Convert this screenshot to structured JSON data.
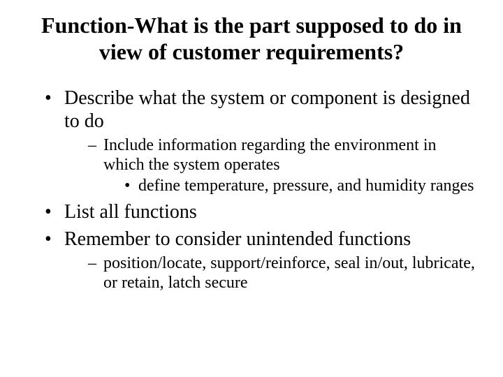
{
  "title": "Function-What is the part supposed to do in view of customer requirements?",
  "bullets": {
    "b1": "Describe what the system or component is designed to do",
    "b1_1": "Include information regarding the environment in which the system operates",
    "b1_1_1": "define temperature, pressure, and humidity ranges",
    "b2": "List all functions",
    "b3": "Remember to consider unintended functions",
    "b3_1": "position/locate, support/reinforce, seal in/out, lubricate, or retain, latch secure"
  }
}
